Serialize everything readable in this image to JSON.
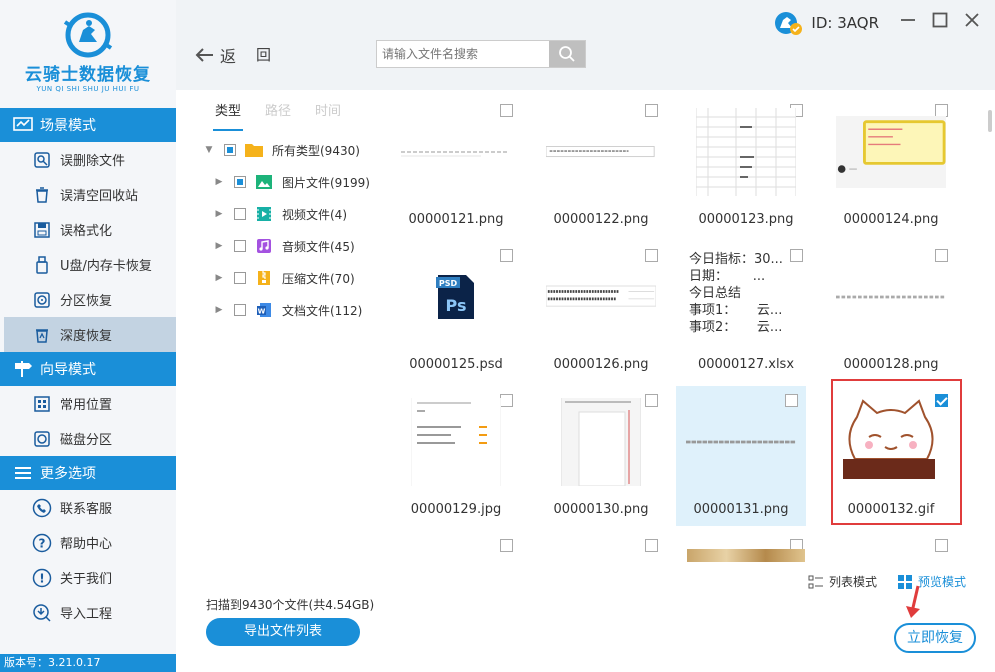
{
  "app": {
    "name": "云骑士数据恢复",
    "subname": "YUN QI SHI SHU JU HUI FU",
    "version": "版本号：3.21.0.17",
    "user_id": "ID: 3AQR"
  },
  "sidebar": {
    "sections": [
      {
        "title": "场景模式",
        "icon": "monitor-icon",
        "items": [
          {
            "label": "误删除文件",
            "icon": "file-search-icon"
          },
          {
            "label": "误清空回收站",
            "icon": "recycle-bin-icon"
          },
          {
            "label": "误格式化",
            "icon": "disk-format-icon"
          },
          {
            "label": "U盘/内存卡恢复",
            "icon": "usb-drive-icon"
          },
          {
            "label": "分区恢复",
            "icon": "partition-icon"
          },
          {
            "label": "深度恢复",
            "icon": "deep-recovery-icon",
            "active": true
          }
        ]
      },
      {
        "title": "向导模式",
        "icon": "signpost-icon",
        "items": [
          {
            "label": "常用位置",
            "icon": "windows-icon"
          },
          {
            "label": "磁盘分区",
            "icon": "disk-partition-icon"
          }
        ]
      },
      {
        "title": "更多选项",
        "icon": "menu-icon",
        "items": [
          {
            "label": "联系客服",
            "icon": "phone-icon"
          },
          {
            "label": "帮助中心",
            "icon": "help-icon"
          },
          {
            "label": "关于我们",
            "icon": "info-icon"
          },
          {
            "label": "导入工程",
            "icon": "import-icon"
          }
        ]
      }
    ]
  },
  "toolbar": {
    "back_label": "返",
    "forward_label": "回",
    "search_placeholder": "请输入文件名搜索"
  },
  "tree": {
    "tabs": [
      "类型",
      "路径",
      "时间"
    ],
    "nodes": [
      {
        "label": "所有类型(9430)",
        "icon": "folder-icon",
        "state": "partial"
      },
      {
        "label": "图片文件(9199)",
        "icon": "image-icon",
        "state": "partial"
      },
      {
        "label": "视频文件(4)",
        "icon": "video-icon",
        "state": "unchecked"
      },
      {
        "label": "音频文件(45)",
        "icon": "music-icon",
        "state": "unchecked"
      },
      {
        "label": "压缩文件(70)",
        "icon": "zip-icon",
        "state": "unchecked"
      },
      {
        "label": "文档文件(112)",
        "icon": "document-icon",
        "state": "unchecked"
      }
    ]
  },
  "files": [
    {
      "name": "00000121.png",
      "checked": false
    },
    {
      "name": "00000122.png",
      "checked": false
    },
    {
      "name": "00000123.png",
      "checked": false
    },
    {
      "name": "00000124.png",
      "checked": false
    },
    {
      "name": "00000125.psd",
      "checked": false,
      "preview_label": "PSD"
    },
    {
      "name": "00000126.png",
      "checked": false
    },
    {
      "name": "00000127.xlsx",
      "checked": false,
      "preview_text": "今日指标：30...\n日期：      ...\n今日总结\n事项1：     云...\n事项2：     云..."
    },
    {
      "name": "00000128.png",
      "checked": false
    },
    {
      "name": "00000129.jpg",
      "checked": false
    },
    {
      "name": "00000130.png",
      "checked": false
    },
    {
      "name": "00000131.png",
      "checked": false,
      "selected_bg": true
    },
    {
      "name": "00000132.gif",
      "checked": true
    }
  ],
  "footer": {
    "scan_info": "扫描到9430个文件(共4.54GB)",
    "export_label": "导出文件列表",
    "list_mode_label": "列表模式",
    "preview_mode_label": "预览模式",
    "recover_label": "立即恢复"
  },
  "colors": {
    "accent": "#1a8fd8",
    "highlight": "#e03c3c"
  }
}
